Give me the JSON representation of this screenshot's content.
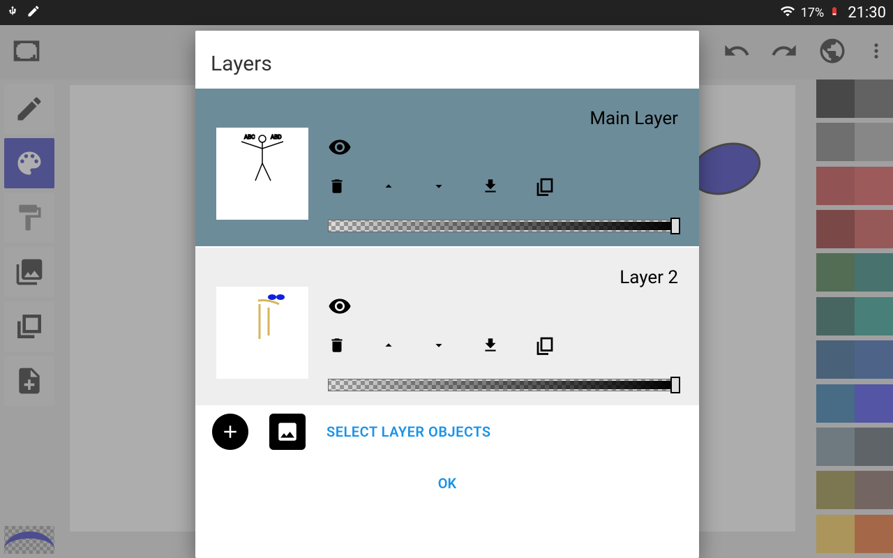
{
  "status": {
    "battery_percent": "17%",
    "time": "21:30"
  },
  "dialog": {
    "title": "Layers",
    "layers": [
      {
        "name": "Main Layer",
        "selected": true
      },
      {
        "name": "Layer 2",
        "selected": false
      }
    ],
    "select_objects_label": "SELECT LAYER OBJECTS",
    "ok_label": "OK"
  },
  "palette": [
    "#000000",
    "#424242",
    "#616161",
    "#9e9e9e",
    "#b71c1c",
    "#d32f2f",
    "#7f0000",
    "#c62828",
    "#1b5e20",
    "#00695c",
    "#004d40",
    "#00897b",
    "#03407a",
    "#0d47a1",
    "#01579b",
    "#1e22e8",
    "#607d8b",
    "#37474f",
    "#827717",
    "#6d4c41",
    "#fbc02d",
    "#e65100"
  ]
}
